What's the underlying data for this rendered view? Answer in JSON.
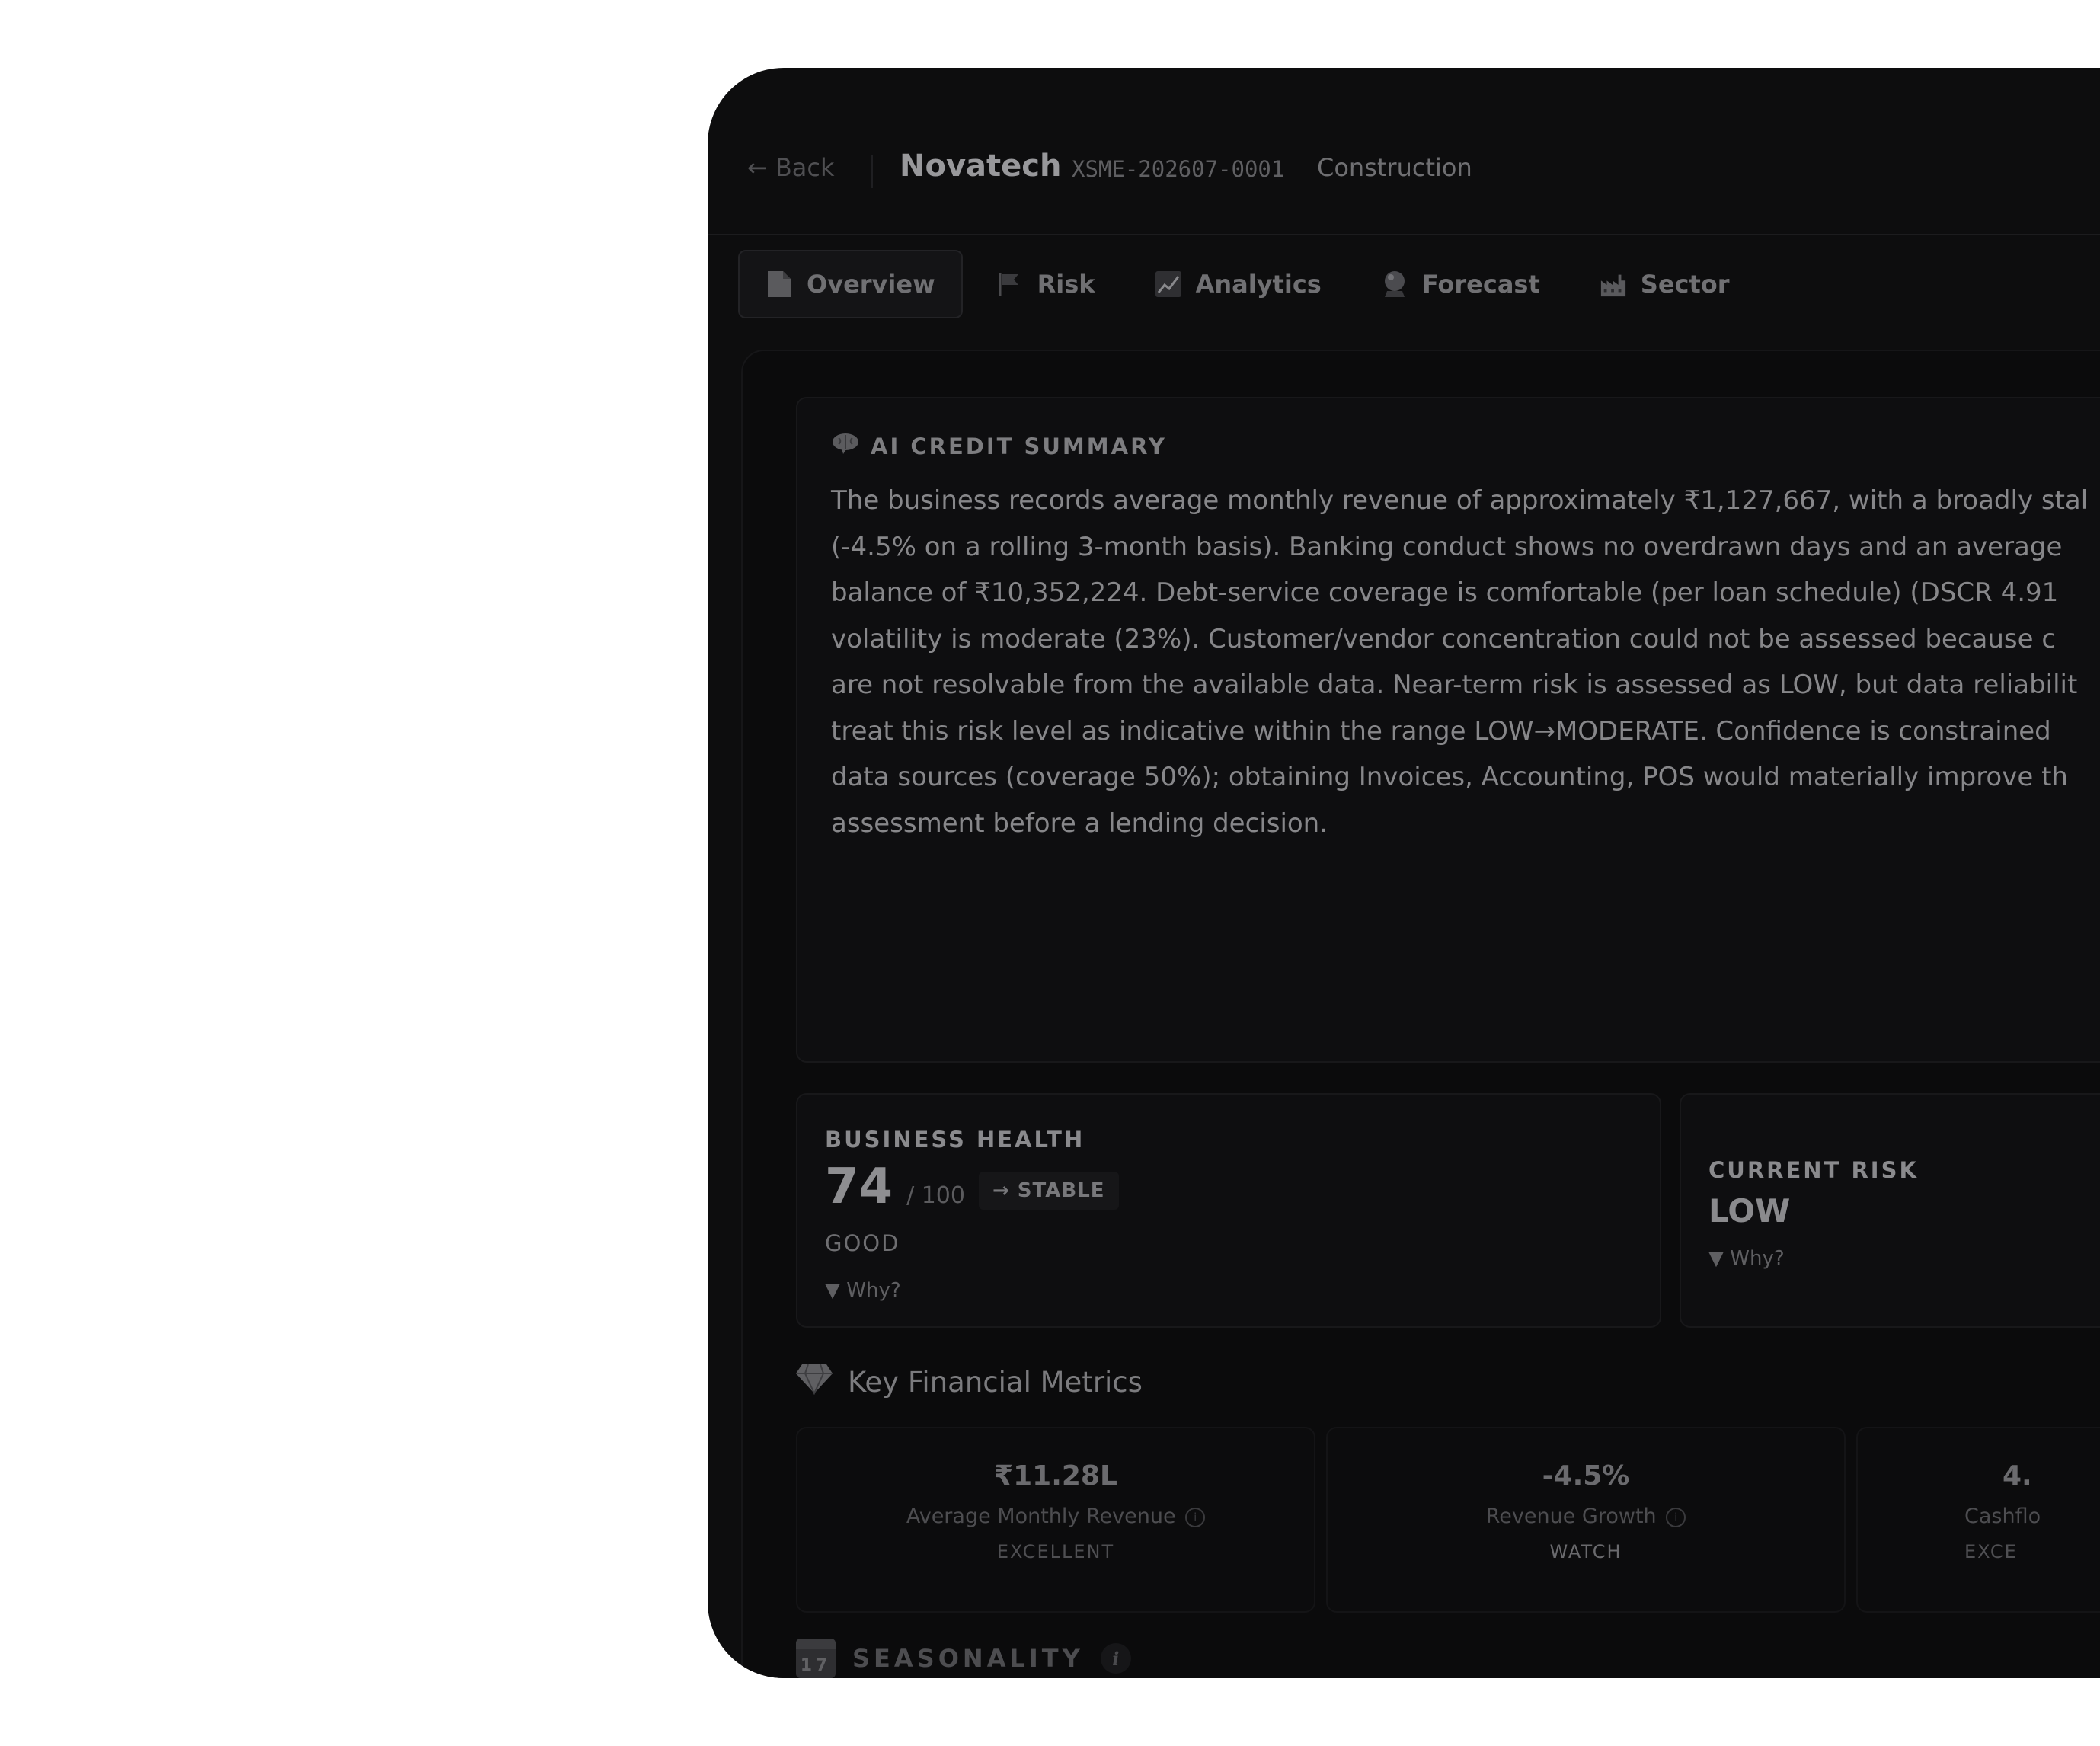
{
  "header": {
    "back_label": "Back",
    "company": "Novatech",
    "code": "XSME-202607-0001",
    "industry": "Construction"
  },
  "tabs": [
    {
      "label": "Overview",
      "icon": "document-icon",
      "active": true
    },
    {
      "label": "Risk",
      "icon": "flag-icon",
      "active": false
    },
    {
      "label": "Analytics",
      "icon": "chart-icon",
      "active": false
    },
    {
      "label": "Forecast",
      "icon": "crystal-ball-icon",
      "active": false
    },
    {
      "label": "Sector",
      "icon": "factory-icon",
      "active": false
    }
  ],
  "summary": {
    "title": "AI CREDIT SUMMARY",
    "lines": [
      "The business records average monthly revenue of approximately ₹1,127,667, with a broadly stal",
      "(-4.5% on a rolling 3-month basis). Banking conduct shows no overdrawn days and an average",
      "balance of ₹10,352,224. Debt-service coverage is comfortable (per loan schedule) (DSCR 4.91",
      "volatility is moderate (23%). Customer/vendor concentration could not be assessed because c",
      "are not resolvable from the available data. Near-term risk is assessed as LOW, but data reliabilit",
      "treat this risk level as indicative within the range LOW→MODERATE. Confidence is constrained",
      "data sources (coverage 50%); obtaining Invoices, Accounting, POS would materially improve th",
      "assessment before a lending decision."
    ]
  },
  "health": {
    "label": "BUSINESS HEALTH",
    "score": "74",
    "max": "/ 100",
    "trend": "→ STABLE",
    "grade": "GOOD",
    "why": "▼ Why?"
  },
  "risk": {
    "label": "CURRENT RISK",
    "value": "LOW",
    "why": "▼ Why?"
  },
  "kfm": {
    "title": "Key Financial Metrics",
    "metrics": [
      {
        "value": "₹11.28L",
        "label": "Average Monthly Revenue",
        "info": "i",
        "rating": "EXCELLENT"
      },
      {
        "value": "-4.5%",
        "label": "Revenue Growth",
        "info": "i",
        "rating": "WATCH"
      },
      {
        "value": "4.",
        "label": "Cashflo",
        "rating": "EXCE"
      }
    ]
  },
  "seasonality": {
    "title": "SEASONALITY",
    "calendar_day": "17",
    "info": "i"
  }
}
